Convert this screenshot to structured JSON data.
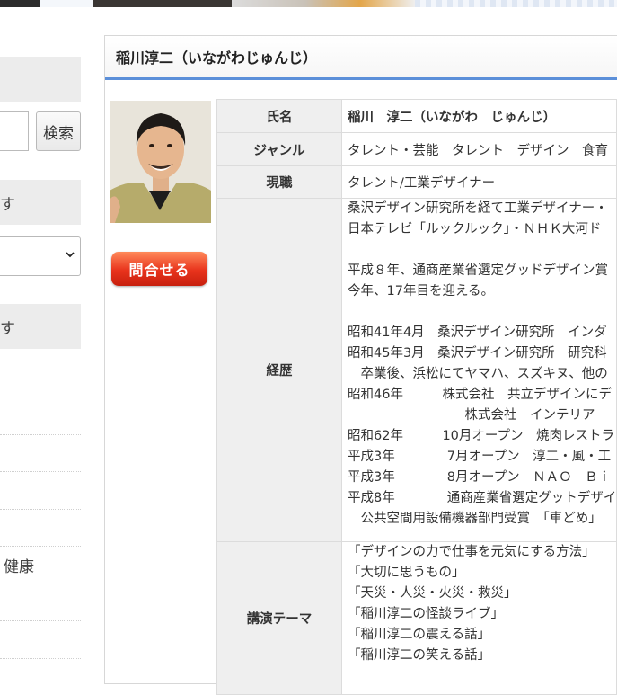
{
  "sidebar": {
    "search_button": "検索",
    "heading1_tail": "す",
    "heading2_tail": "す",
    "item_health_tail": "健康"
  },
  "profile": {
    "title": "稲川淳二（いながわじゅんじ）",
    "contact_label": "問合せる",
    "rows": {
      "name": {
        "label": "氏名",
        "value": "稲川　淳二（いながわ　じゅんじ）"
      },
      "genre": {
        "label": "ジャンル",
        "value": "タレント・芸能　タレント　デザイン　食育"
      },
      "job": {
        "label": "現職",
        "value": "タレント/工業デザイナー"
      },
      "career": {
        "label": "経歴",
        "lines": [
          "桑沢デザイン研究所を経て工業デザイナー・",
          "日本テレビ「ルックルック」・ＮＨＫ大河ド",
          "",
          "平成８年、通商産業省選定グッドデザイン賞",
          "今年、17年目を迎える。",
          "",
          "昭和41年4月　桑沢デザイン研究所　インダ",
          "昭和45年3月　桑沢デザイン研究所　研究科",
          "　卒業後、浜松にてヤマハ、スズキヌ、他の",
          "昭和46年　　　株式会社　共立デザインにデ",
          "　　　　　　　　　株式会社　インテリア",
          "昭和62年　　　10月オープン　焼肉レストラ",
          "平成3年　　　　7月オープン　淳二・風・工",
          "平成3年　　　　8月オープン　ＮＡＯ　Ｂｉ",
          "平成8年　　　　通商産業省選定グットデザイ",
          "　公共空間用設備機器部門受賞　「車どめ」"
        ]
      },
      "themes": {
        "label": "講演テーマ",
        "lines": [
          "「デザインの力で仕事を元気にする方法」",
          "「大切に思うもの」",
          "「天災・人災・火災・救災」",
          "「稲川淳二の怪談ライブ」",
          "「稲川淳二の震える話」",
          "「稲川淳二の笑える話」"
        ]
      }
    }
  },
  "colors": {
    "accent": "#5b8fd9",
    "header_bg": "#efefef",
    "contact_btn": "#e8331c"
  }
}
